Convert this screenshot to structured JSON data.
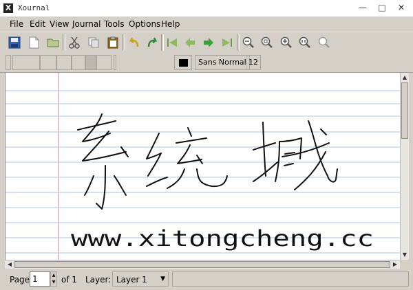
{
  "window": {
    "title": "Xournal",
    "icon": "app-x-icon"
  },
  "menu": {
    "items": [
      {
        "label": "File"
      },
      {
        "label": "Edit"
      },
      {
        "label": "View"
      },
      {
        "label": "Journal"
      },
      {
        "label": "Tools"
      },
      {
        "label": "Options"
      },
      {
        "label": "Help"
      }
    ]
  },
  "toolbar2": {
    "font_name": "Sans Normal",
    "font_size": "12",
    "pen_color": "#000000"
  },
  "page": {
    "handwriting_line1": "系统城",
    "handwriting_line2": "www.xitongcheng.cc"
  },
  "status": {
    "page_label": "Page",
    "page_value": "1",
    "of_label": "of 1",
    "layer_label": "Layer:",
    "layer_value": "Layer 1"
  },
  "colors": {
    "ruled_line": "#a8c4e8",
    "margin_line": "#e8a8c8",
    "chrome": "#d4d0c8"
  }
}
